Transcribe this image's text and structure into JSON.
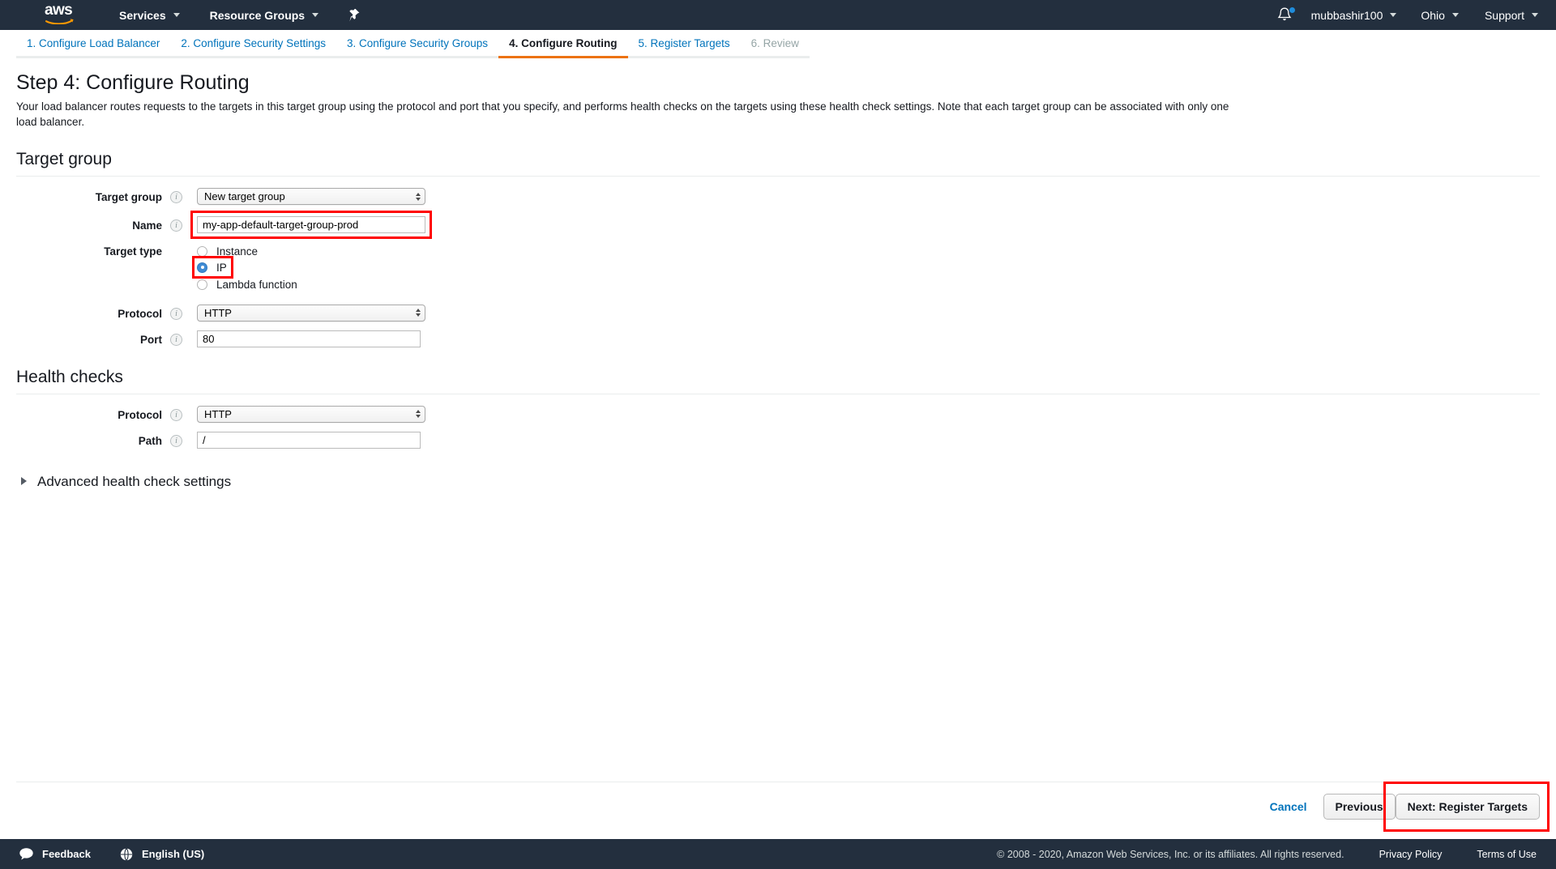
{
  "topnav": {
    "logo_alt": "aws",
    "services_label": "Services",
    "resource_groups_label": "Resource Groups",
    "pin_icon": "pin-icon",
    "bell_icon": "bell-icon",
    "user_label": "mubbashir100",
    "region_label": "Ohio",
    "support_label": "Support"
  },
  "wizard": {
    "steps": [
      {
        "label": "1. Configure Load Balancer",
        "state": "done"
      },
      {
        "label": "2. Configure Security Settings",
        "state": "done"
      },
      {
        "label": "3. Configure Security Groups",
        "state": "done"
      },
      {
        "label": "4. Configure Routing",
        "state": "active"
      },
      {
        "label": "5. Register Targets",
        "state": "done"
      },
      {
        "label": "6. Review",
        "state": "disabled"
      }
    ]
  },
  "page": {
    "title": "Step 4: Configure Routing",
    "description": "Your load balancer routes requests to the targets in this target group using the protocol and port that you specify, and performs health checks on the targets using these health check settings. Note that each target group can be associated with only one load balancer."
  },
  "target_group": {
    "section_title": "Target group",
    "fields": {
      "target_group": {
        "label": "Target group",
        "value": "New target group",
        "info": "info-icon"
      },
      "name": {
        "label": "Name",
        "value": "my-app-default-target-group-prod",
        "info": "info-icon"
      },
      "target_type": {
        "label": "Target type",
        "options": [
          {
            "label": "Instance",
            "selected": false
          },
          {
            "label": "IP",
            "selected": true
          },
          {
            "label": "Lambda function",
            "selected": false
          }
        ]
      },
      "protocol": {
        "label": "Protocol",
        "value": "HTTP",
        "info": "info-icon"
      },
      "port": {
        "label": "Port",
        "value": "80",
        "info": "info-icon"
      }
    }
  },
  "health_checks": {
    "section_title": "Health checks",
    "fields": {
      "protocol": {
        "label": "Protocol",
        "value": "HTTP",
        "info": "info-icon"
      },
      "path": {
        "label": "Path",
        "value": "/",
        "info": "info-icon"
      }
    },
    "advanced_label": "Advanced health check settings"
  },
  "actions": {
    "cancel_label": "Cancel",
    "previous_label": "Previous",
    "next_label": "Next: Register Targets"
  },
  "bottombar": {
    "feedback_label": "Feedback",
    "language_label": "English (US)",
    "copyright": "© 2008 - 2020, Amazon Web Services, Inc. or its affiliates. All rights reserved.",
    "privacy_label": "Privacy Policy",
    "terms_label": "Terms of Use"
  },
  "colors": {
    "nav_bg": "#232f3e",
    "accent_orange": "#ec7211",
    "link_blue": "#0073bb",
    "highlight_red": "#ff0000",
    "radio_blue": "#3f8bd4"
  }
}
